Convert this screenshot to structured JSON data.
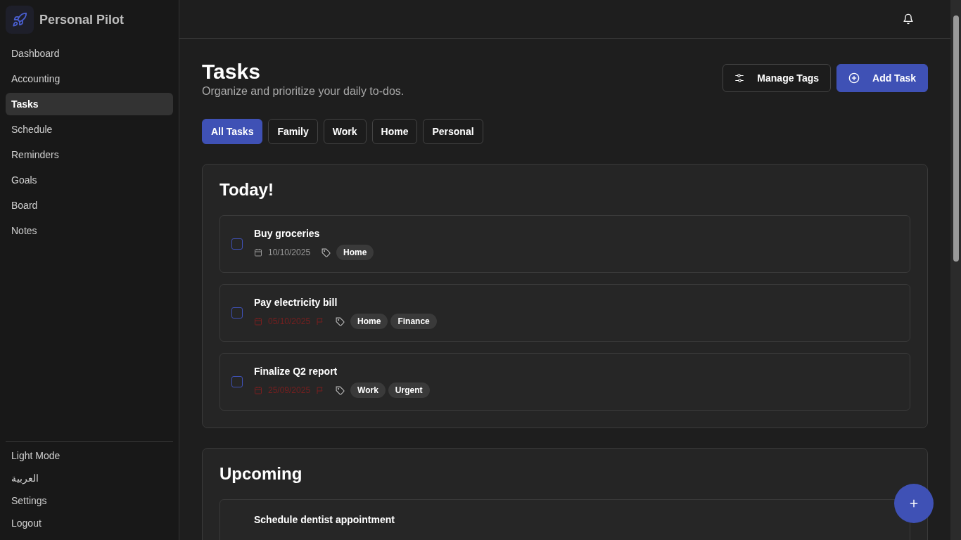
{
  "app": {
    "name": "Personal Pilot"
  },
  "sidebar": {
    "items": [
      {
        "label": "Dashboard",
        "selected": false
      },
      {
        "label": "Accounting",
        "selected": false
      },
      {
        "label": "Tasks",
        "selected": true
      },
      {
        "label": "Schedule",
        "selected": false
      },
      {
        "label": "Reminders",
        "selected": false
      },
      {
        "label": "Goals",
        "selected": false
      },
      {
        "label": "Board",
        "selected": false
      },
      {
        "label": "Notes",
        "selected": false
      }
    ],
    "footer_items": [
      "Light Mode",
      "العربية",
      "Settings",
      "Logout"
    ]
  },
  "page": {
    "title": "Tasks",
    "subtitle": "Organize and prioritize your daily to-dos.",
    "buttons": [
      {
        "label": "Manage Tags",
        "kind": "secondary"
      },
      {
        "label": "Add Task",
        "kind": "primary"
      }
    ]
  },
  "filters": [
    {
      "label": "All Tasks",
      "selected": true
    },
    {
      "label": "Family",
      "selected": false
    },
    {
      "label": "Work",
      "selected": false
    },
    {
      "label": "Home",
      "selected": false
    },
    {
      "label": "Personal",
      "selected": false
    }
  ],
  "sections": [
    {
      "title": "Today!",
      "tasks": [
        {
          "title": "Buy groceries",
          "checked": false,
          "date": "10/10/2025",
          "overdue": false,
          "tags": [
            "Home"
          ]
        },
        {
          "title": "Pay electricity bill",
          "checked": false,
          "date": "05/10/2025",
          "overdue": true,
          "tags": [
            "Home",
            "Finance"
          ]
        },
        {
          "title": "Finalize Q2 report",
          "checked": false,
          "date": "25/09/2025",
          "overdue": true,
          "tags": [
            "Work",
            "Urgent"
          ]
        }
      ]
    },
    {
      "title": "Upcoming",
      "tasks": [
        {
          "title": "Schedule dentist appointment"
        }
      ]
    }
  ]
}
